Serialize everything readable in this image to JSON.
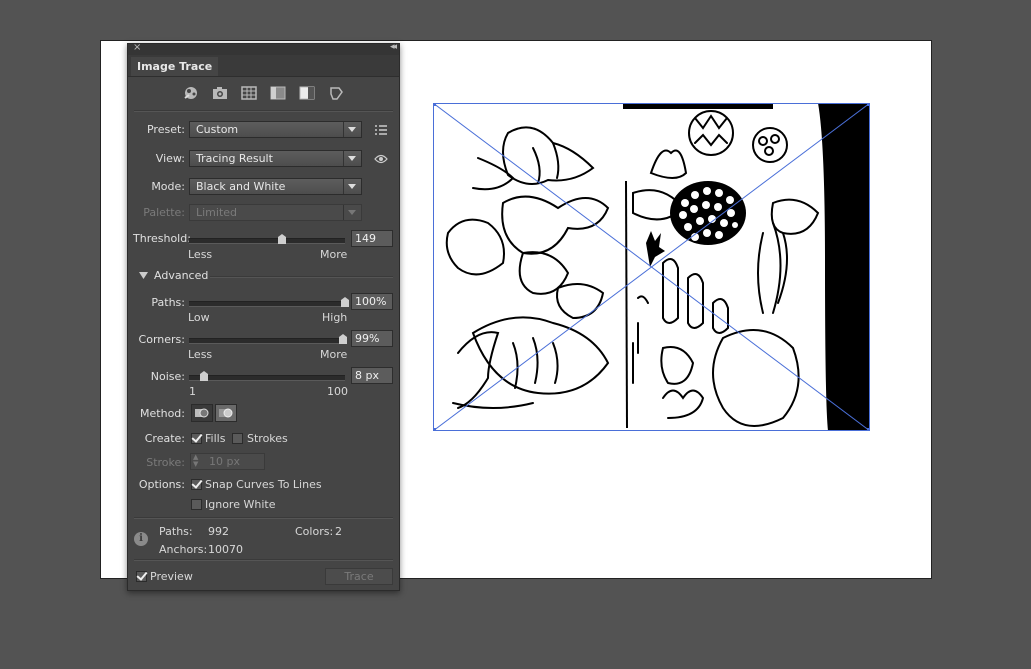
{
  "panel": {
    "title": "Image Trace",
    "preset_icons": [
      "auto-color-icon",
      "high-color-icon",
      "low-color-icon",
      "grayscale-icon",
      "black-white-icon",
      "outline-icon"
    ],
    "preset": {
      "label": "Preset:",
      "value": "Custom"
    },
    "view": {
      "label": "View:",
      "value": "Tracing Result"
    },
    "mode": {
      "label": "Mode:",
      "value": "Black and White"
    },
    "palette": {
      "label": "Palette:",
      "value": "Limited"
    },
    "threshold": {
      "label": "Threshold:",
      "value": "149",
      "min_label": "Less",
      "max_label": "More",
      "level": 149,
      "range": [
        1,
        255
      ]
    },
    "advanced_label": "Advanced",
    "paths": {
      "label": "Paths:",
      "value": "100%",
      "min_label": "Low",
      "max_label": "High",
      "level": 100
    },
    "corners": {
      "label": "Corners:",
      "value": "99%",
      "min_label": "Less",
      "max_label": "More",
      "level": 99
    },
    "noise": {
      "label": "Noise:",
      "value": "8 px",
      "min_label": "1",
      "max_label": "100",
      "level": 8
    },
    "method_label": "Method:",
    "create": {
      "label": "Create:",
      "fills_label": "Fills",
      "fills_checked": true,
      "strokes_label": "Strokes",
      "strokes_checked": false
    },
    "stroke": {
      "label": "Stroke:",
      "value": "10 px"
    },
    "options": {
      "label": "Options:",
      "snap_label": "Snap Curves To Lines",
      "snap_checked": true,
      "ignore_white_label": "Ignore White",
      "ignore_white_checked": false
    },
    "stats": {
      "paths_label": "Paths:",
      "paths_value": "992",
      "colors_label": "Colors:",
      "colors_value": "2",
      "anchors_label": "Anchors:",
      "anchors_value": "10070"
    },
    "preview_label": "Preview",
    "preview_checked": true,
    "trace_label": "Trace"
  },
  "colors": {
    "canvas": "#535353",
    "panel": "#454545",
    "selection": "#4a6fd8"
  }
}
